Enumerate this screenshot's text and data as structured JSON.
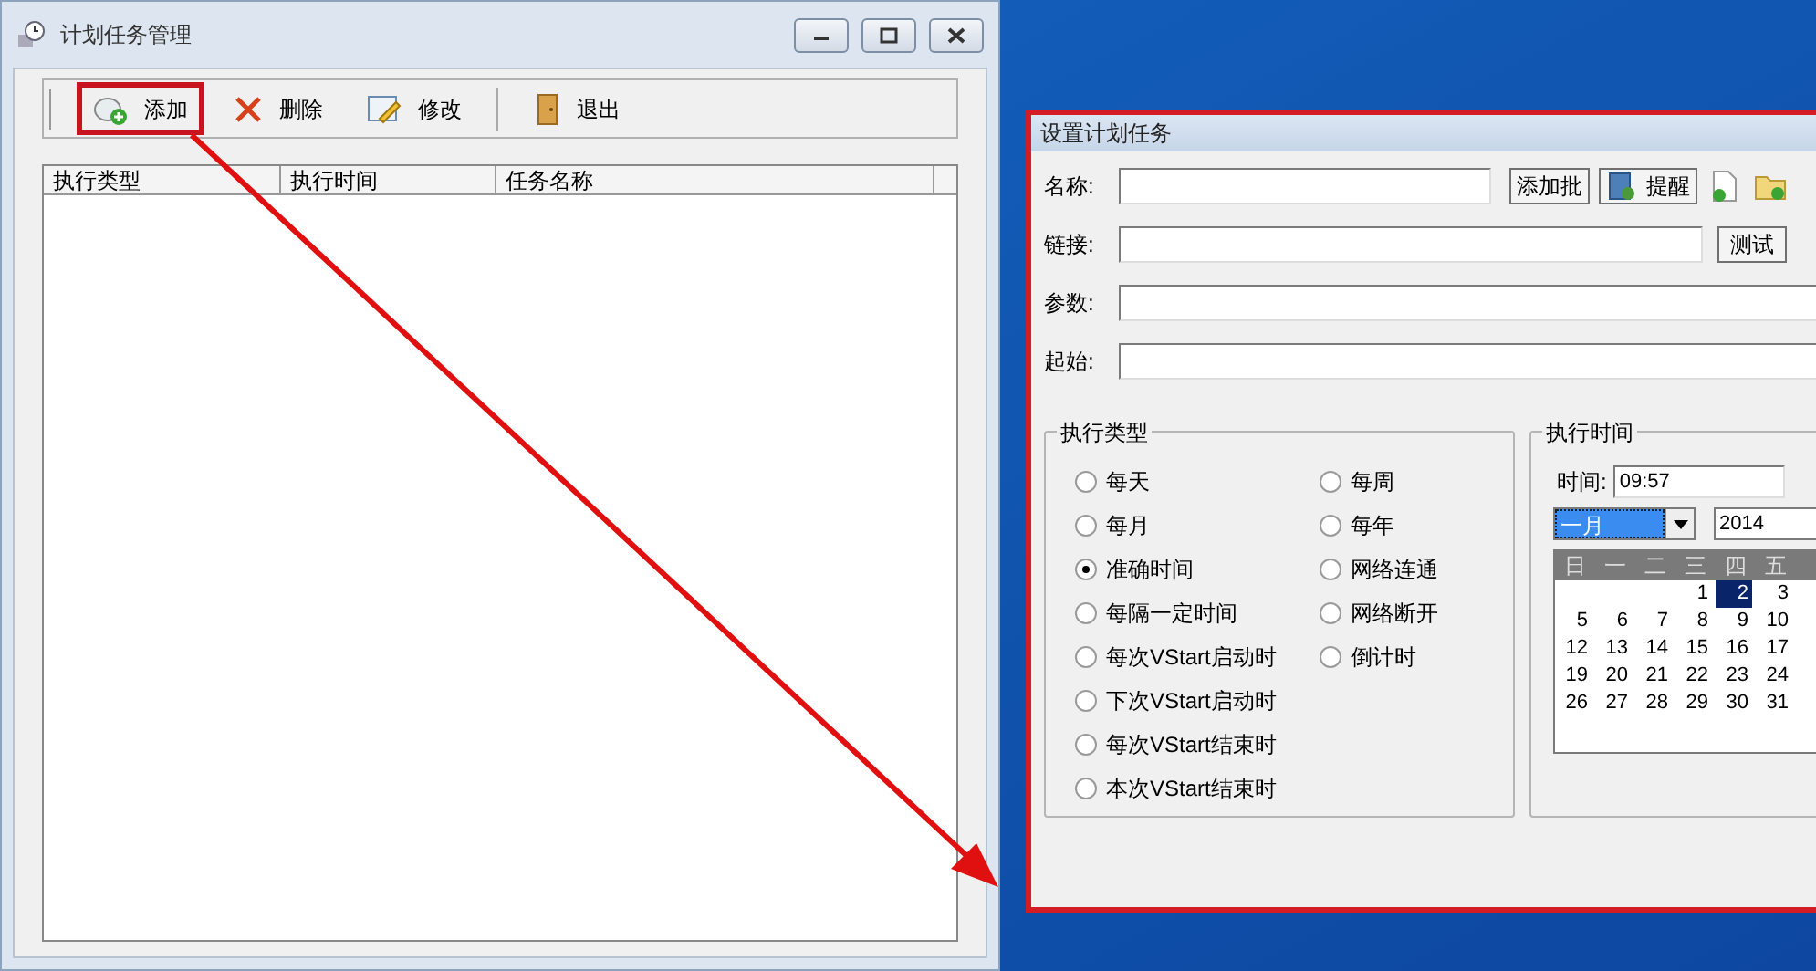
{
  "main_window": {
    "title": "计划任务管理",
    "toolbar": [
      {
        "kind": "add",
        "label": "添加",
        "highlighted": true
      },
      {
        "kind": "delete",
        "label": "删除",
        "highlighted": false
      },
      {
        "kind": "edit",
        "label": "修改",
        "highlighted": false
      },
      {
        "kind": "exit",
        "label": "退出",
        "highlighted": false
      }
    ],
    "table": {
      "columns": [
        "执行类型",
        "执行时间",
        "任务名称"
      ]
    }
  },
  "dialog": {
    "title": "设置计划任务",
    "fields": [
      {
        "label": "名称:",
        "kind": "name"
      },
      {
        "label": "链接:",
        "kind": "link"
      },
      {
        "label": "参数:",
        "kind": "wide"
      },
      {
        "label": "起始:",
        "kind": "wide"
      }
    ],
    "name_buttons": [
      "添加批",
      "提醒"
    ],
    "link_button": "测试",
    "execution_type": {
      "title": "执行类型",
      "columns": [
        [
          {
            "label": "每天",
            "selected": false
          },
          {
            "label": "每月",
            "selected": false
          },
          {
            "label": "准确时间",
            "selected": true
          },
          {
            "label": "每隔一定时间",
            "selected": false
          },
          {
            "label": "每次VStart启动时",
            "selected": false
          },
          {
            "label": "下次VStart启动时",
            "selected": false
          },
          {
            "label": "每次VStart结束时",
            "selected": false
          },
          {
            "label": "本次VStart结束时",
            "selected": false
          }
        ],
        [
          {
            "label": "每周",
            "selected": false
          },
          {
            "label": "每年",
            "selected": false
          },
          {
            "label": "网络连通",
            "selected": false
          },
          {
            "label": "网络断开",
            "selected": false
          },
          {
            "label": "倒计时",
            "selected": false
          }
        ]
      ]
    },
    "execution_time": {
      "title": "执行时间",
      "time_label": "时间:",
      "time": "09:57",
      "month": "一月",
      "year": "2014",
      "weekdays": [
        "日",
        "一",
        "二",
        "三",
        "四",
        "五"
      ],
      "weeks": [
        [
          {
            "day": "1",
            "selected": false
          },
          {
            "day": "2",
            "selected": true
          },
          {
            "day": "3",
            "selected": false
          }
        ],
        [
          {
            "day": "5",
            "selected": false
          },
          {
            "day": "6",
            "selected": false
          },
          {
            "day": "7",
            "selected": false
          },
          {
            "day": "8",
            "selected": false
          },
          {
            "day": "9",
            "selected": false
          },
          {
            "day": "10",
            "selected": false
          }
        ],
        [
          {
            "day": "12",
            "selected": false
          },
          {
            "day": "13",
            "selected": false
          },
          {
            "day": "14",
            "selected": false
          },
          {
            "day": "15",
            "selected": false
          },
          {
            "day": "16",
            "selected": false
          },
          {
            "day": "17",
            "selected": false
          }
        ],
        [
          {
            "day": "19",
            "selected": false
          },
          {
            "day": "20",
            "selected": false
          },
          {
            "day": "21",
            "selected": false
          },
          {
            "day": "22",
            "selected": false
          },
          {
            "day": "23",
            "selected": false
          },
          {
            "day": "24",
            "selected": false
          }
        ],
        [
          {
            "day": "26",
            "selected": false
          },
          {
            "day": "27",
            "selected": false
          },
          {
            "day": "28",
            "selected": false
          },
          {
            "day": "29",
            "selected": false
          },
          {
            "day": "30",
            "selected": false
          },
          {
            "day": "31",
            "selected": false
          }
        ]
      ]
    }
  }
}
